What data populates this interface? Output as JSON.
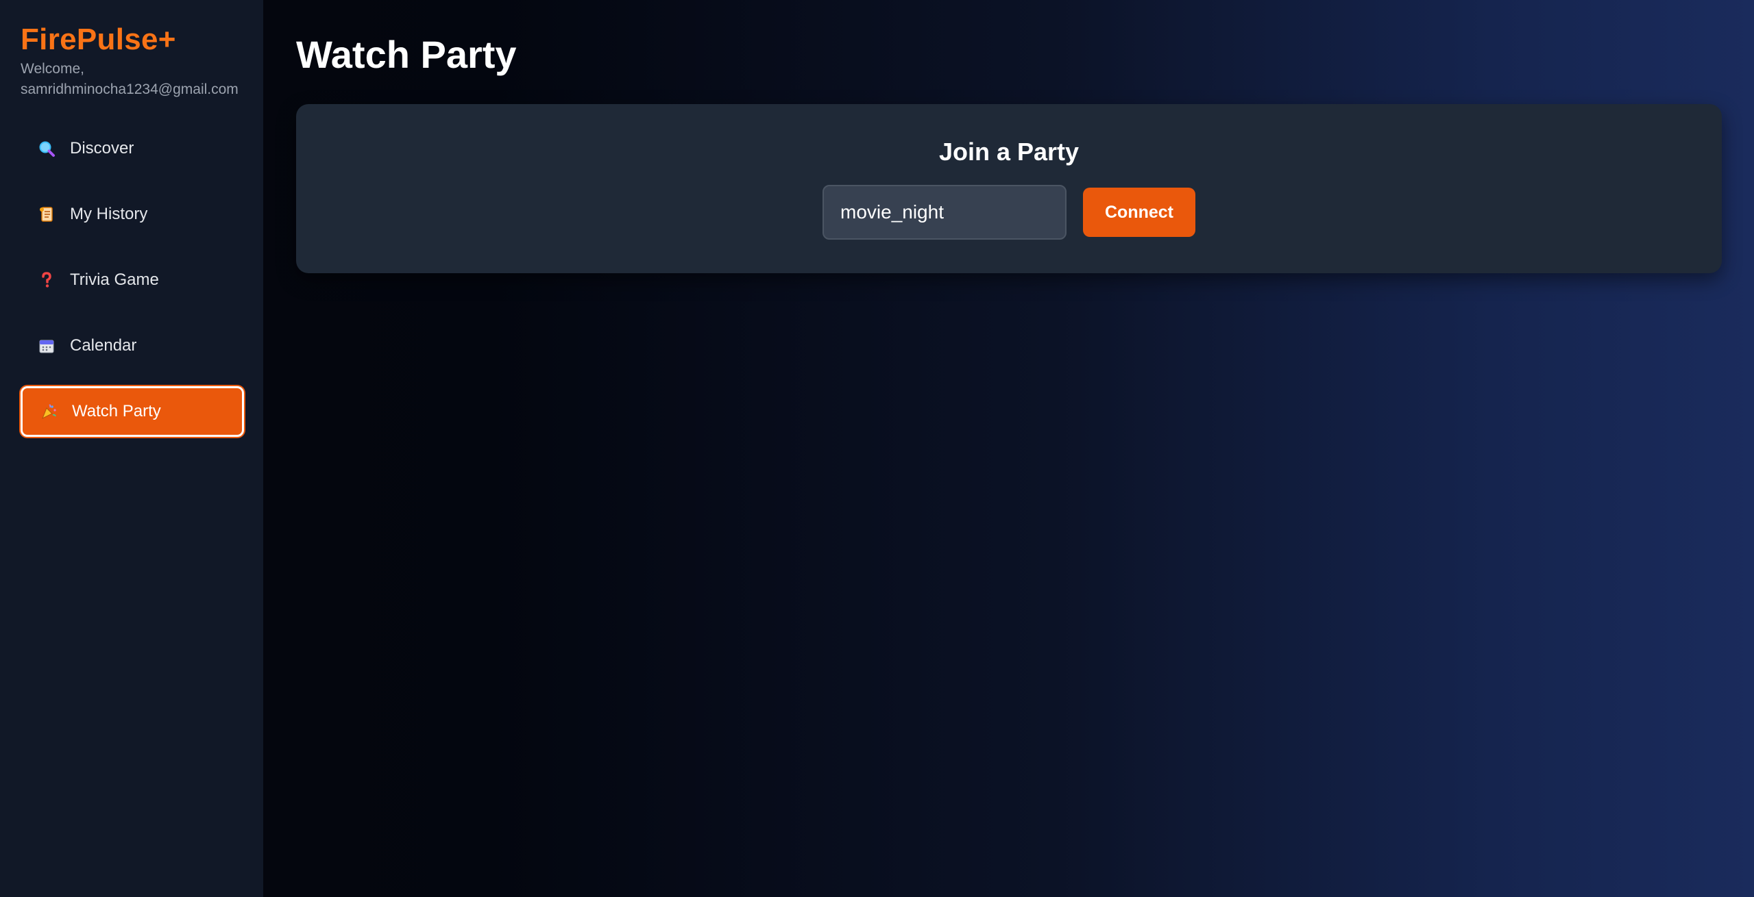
{
  "sidebar": {
    "brand": "FirePulse+",
    "welcome_label": "Welcome,",
    "user_email": "samridhminocha1234@gmail.com",
    "items": [
      {
        "label": "Discover",
        "icon": "magnifier-icon",
        "active": false
      },
      {
        "label": "My History",
        "icon": "scroll-icon",
        "active": false
      },
      {
        "label": "Trivia Game",
        "icon": "question-mark-icon",
        "active": false
      },
      {
        "label": "Calendar",
        "icon": "calendar-icon",
        "active": false
      },
      {
        "label": "Watch Party",
        "icon": "party-icon",
        "active": true
      }
    ]
  },
  "main": {
    "title": "Watch Party",
    "join_card": {
      "title": "Join a Party",
      "room_input_value": "movie_night",
      "connect_label": "Connect"
    }
  },
  "colors": {
    "accent": "#ea580c",
    "brand": "#f97316",
    "sidebar_bg": "#111827",
    "card_bg": "#1f2937",
    "input_bg": "#374151"
  }
}
